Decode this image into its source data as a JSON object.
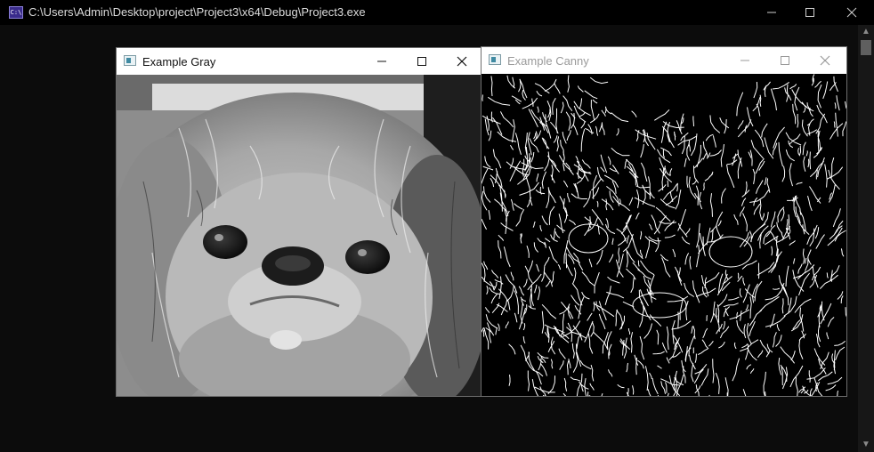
{
  "console": {
    "title": "C:\\Users\\Admin\\Desktop\\project\\Project3\\x64\\Debug\\Project3.exe",
    "icon": "console-app-icon",
    "icon_text": "C:\\",
    "minimize_glyph": "—",
    "maximize_glyph": "☐",
    "close_glyph": "✕"
  },
  "windows": {
    "gray": {
      "title": "Example Gray",
      "icon": "image-window-icon"
    },
    "canny": {
      "title": "Example Canny",
      "icon": "image-window-icon"
    }
  },
  "colors": {
    "console_bg": "#0c0c0c",
    "titlebar_bg": "#000000",
    "window_bg": "#ffffff",
    "edge_color": "#ffffff",
    "edge_bg": "#000000"
  }
}
